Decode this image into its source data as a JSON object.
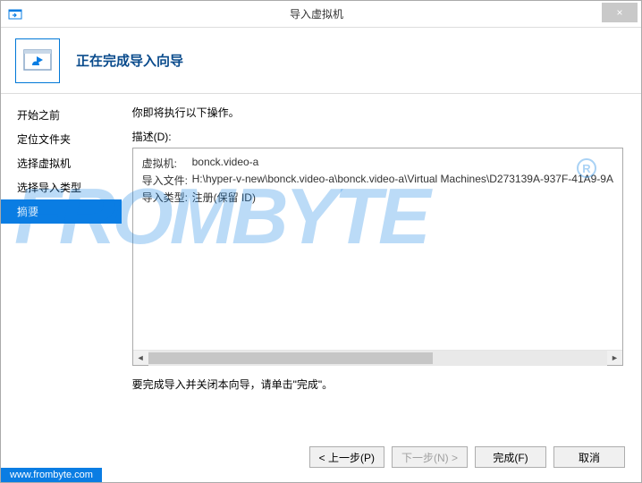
{
  "window": {
    "title": "导入虚拟机",
    "close": "×"
  },
  "header": {
    "title": "正在完成导入向导"
  },
  "sidebar": {
    "items": [
      {
        "label": "开始之前"
      },
      {
        "label": "定位文件夹"
      },
      {
        "label": "选择虚拟机"
      },
      {
        "label": "选择导入类型"
      },
      {
        "label": "摘要"
      }
    ],
    "active_index": 4
  },
  "content": {
    "instruction": "你即将执行以下操作。",
    "desc_label": "描述(D):",
    "rows": [
      {
        "k": "虚拟机:",
        "v": "bonck.video-a"
      },
      {
        "k": "导入文件:",
        "v": "H:\\hyper-v-new\\bonck.video-a\\bonck.video-a\\Virtual Machines\\D273139A-937F-41A9-9A"
      },
      {
        "k": "导入类型:",
        "v": "注册(保留 ID)"
      }
    ],
    "finish_text": "要完成导入并关闭本向导，请单击\"完成\"。"
  },
  "buttons": {
    "prev": "< 上一步(P)",
    "next": "下一步(N) >",
    "finish": "完成(F)",
    "cancel": "取消"
  },
  "watermark": {
    "text": "FROMBYTE",
    "url": "www.frombyte.com",
    "reg": "R"
  }
}
